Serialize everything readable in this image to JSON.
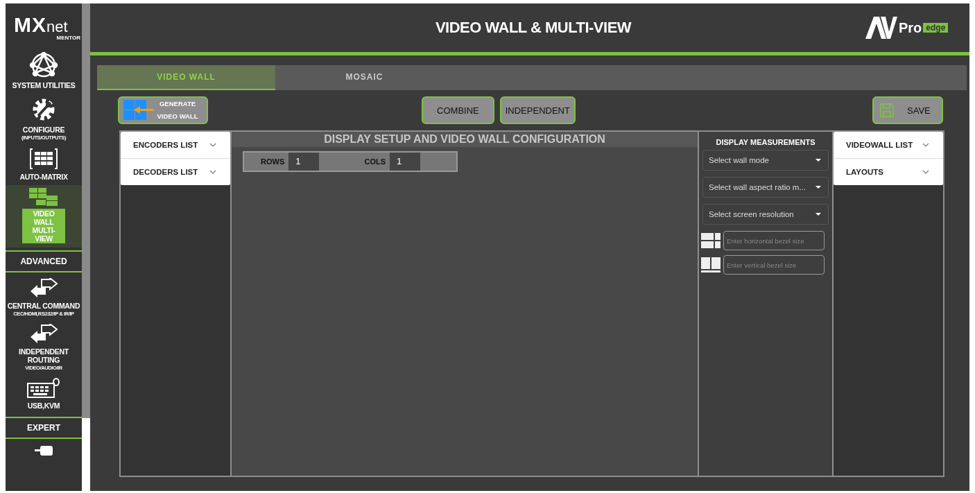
{
  "logo": {
    "main": "MX",
    "suffix": "net",
    "sub": "MENTOR"
  },
  "sidebar": {
    "items": [
      {
        "kind": "nav",
        "label": "SYSTEM UTILITIES",
        "selected": false
      },
      {
        "kind": "nav",
        "label": "CONFIGURE",
        "sublabel": "(INPUTS/OUTPUTS)",
        "selected": false
      },
      {
        "kind": "nav",
        "label": "AUTO-MATRIX",
        "selected": false
      },
      {
        "kind": "nav",
        "label": "VIDEO WALL MULTI-VIEW",
        "selected": true
      },
      {
        "kind": "section",
        "label": "ADVANCED"
      },
      {
        "kind": "nav",
        "label": "CENTRAL COMMAND",
        "sublabel": "CEC/HDMI,RS232/IP & IR/IP",
        "selected": false
      },
      {
        "kind": "nav",
        "label": "INDEPENDENT ROUTING",
        "sublabel": "VIDEO/AUDIO/IR",
        "selected": false
      },
      {
        "kind": "nav",
        "label": "USB,KVM",
        "selected": false
      },
      {
        "kind": "section",
        "label": "EXPERT"
      },
      {
        "kind": "nav",
        "selected": false
      }
    ]
  },
  "header": {
    "title": "VIDEO WALL & MULTI-VIEW",
    "brand": {
      "main": "Pro",
      "tag": "edge"
    }
  },
  "tabs": [
    {
      "label": "VIDEO WALL",
      "selected": true
    },
    {
      "label": "MOSAIC",
      "selected": false
    }
  ],
  "toolbar": {
    "generate": "GENERATE VIDEO WALL",
    "modes": [
      "COMBINE",
      "INDEPENDENT"
    ],
    "save": "SAVE"
  },
  "left_lists": [
    "ENCODERS LIST",
    "DECODERS LIST"
  ],
  "config": {
    "title": "DISPLAY SETUP AND VIDEO WALL CONFIGURATION",
    "rows_label": "ROWS",
    "rows": "1",
    "cols_label": "COLS",
    "cols": "1"
  },
  "measurements": {
    "title": "DISPLAY MEASUREMENTS",
    "selects": [
      "Select wall mode",
      "Select wall aspect ratio m...",
      "Select screen resolution"
    ],
    "horizontal_bezel": {
      "placeholder": "Enter horizontal bezel size"
    },
    "vertical_bezel": {
      "placeholder": "Enter vertical bezel size"
    }
  },
  "right_lists": [
    "VIDEOWALL LIST",
    "LAYOUTS"
  ]
}
